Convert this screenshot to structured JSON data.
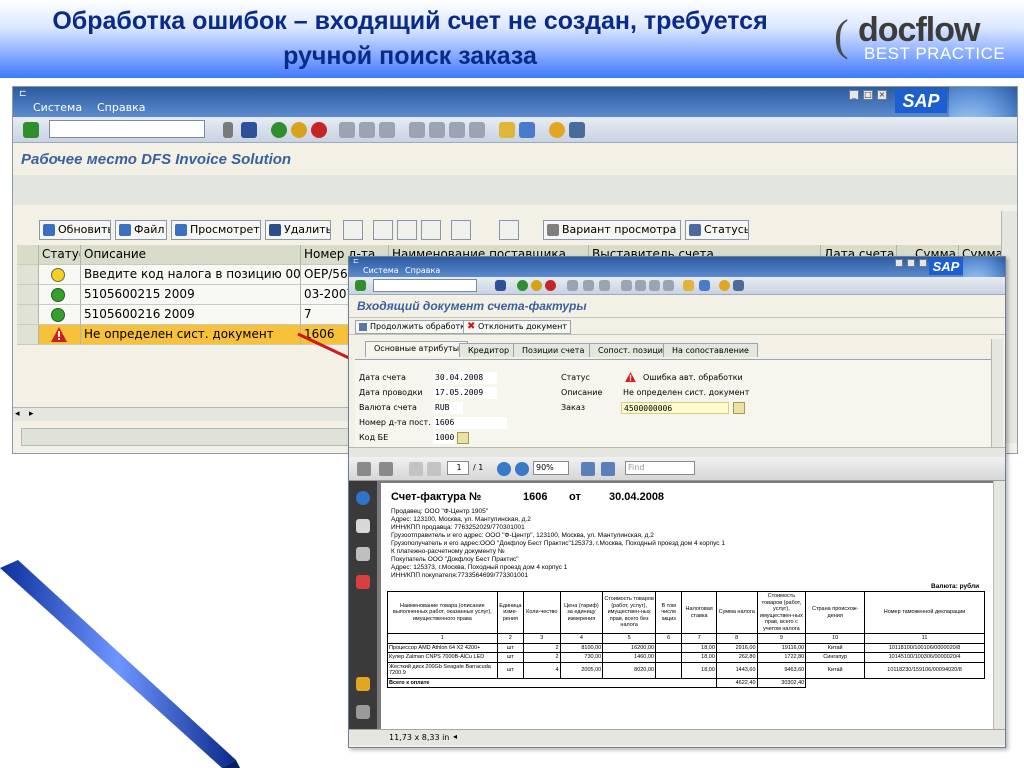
{
  "slide": {
    "title": "Обработка ошибок – входящий счет не создан, требуется ручной поиск заказа",
    "logo_word": "docflow",
    "logo_sub": "BEST PRACTICE"
  },
  "back_window": {
    "menu": [
      "Система",
      "Справка"
    ],
    "sap_logo": "SAP",
    "title": "Рабочее место DFS Invoice Solution",
    "alv_buttons": [
      "Обновить",
      "Файл",
      "Просмотреть",
      "Удалить",
      "Вариант просмотра",
      "Статусы"
    ],
    "columns": [
      "Статус",
      "Описание",
      "Номер д-та",
      "Наименование поставщика",
      "Выставитель счета",
      "Дата счета",
      "Сумма",
      "Сумма"
    ],
    "rows": [
      {
        "status": "warning",
        "description": "Введите код налога в позицию 000001",
        "doc": "OEP/563"
      },
      {
        "status": "ok",
        "description": "5105600215 2009",
        "doc": "03-2007/"
      },
      {
        "status": "ok",
        "description": "5105600216 2009",
        "doc": "7"
      },
      {
        "status": "error",
        "description": "Не определен сист. документ",
        "doc": "1606"
      }
    ]
  },
  "front_window": {
    "menu": [
      "Система",
      "Справка"
    ],
    "sap_logo": "SAP",
    "title": "Входящий документ счета-фактуры",
    "actions": [
      "Продолжить обработку",
      "Отклонить документ"
    ],
    "tabs": [
      "Основные атрибуты",
      "Кредитор",
      "Позиции счета",
      "Сопост. позиции",
      "На сопоставление"
    ],
    "fields_left": [
      {
        "label": "Дата счета",
        "value": "30.04.2008"
      },
      {
        "label": "Дата проводки",
        "value": "17.05.2009"
      },
      {
        "label": "Валюта счета",
        "value": "RUB"
      },
      {
        "label": "Номер д-та пост.",
        "value": "1606"
      },
      {
        "label": "Код БЕ",
        "value": "1000"
      }
    ],
    "fields_right": [
      {
        "label": "Статус",
        "value": "Ошибка авт. обработки"
      },
      {
        "label": "Описание",
        "value": "Не определен сист. документ"
      },
      {
        "label": "Заказ",
        "value": "4500000006"
      }
    ]
  },
  "pdf_viewer": {
    "page_current": "1",
    "page_total": "/ 1",
    "zoom": "90%",
    "find_placeholder": "Find",
    "page_size": "11,73 x 8,33 in"
  },
  "invoice": {
    "title": "Счет-фактура №",
    "number": "1606",
    "ot": "от",
    "date": "30.04.2008",
    "lines": [
      "Продавец: ООО \"Ф-Центр 1905\"",
      "Адрес: 123100, Москва, ул. Мантулинская, д.2",
      "ИНН/КПП продавца: 7763252029/770301001",
      "Грузоотправитель и его адрес: ООО \"Ф-Центр\", 123100, Москва, ул. Мантулинская, д.2",
      "Грузополучатель и его адрес:ООО \"Докфлоу Бест Практис\"125373, г.Москва, Походный проезд дом 4 корпус 1",
      "К платежно-расчетному документу №",
      "Покупатель ООО \"Докфлоу Бест Практис\"",
      "Адрес: 125373, г.Москва, Походный проезд дом 4 корпус 1",
      "ИНН/КПП покупателя:7733564699/773301001"
    ],
    "currency": "Валюта: рубли",
    "headers": [
      "Наименование товара (описание выполненных работ, оказанных услуг), имущественного права",
      "Единица изме-рения",
      "Коли-чество",
      "Цена (тариф) за единицу измерения",
      "Стоимость товаров (работ, услуг), имуществен-ных прав, всего без налога",
      "В том числе акциз",
      "Налоговая ставка",
      "Сумма налога",
      "Стоимость товаров (работ, услуг), имуществен-ных прав, всего с учетом налога",
      "Страна происхож-дения",
      "Номер таможенной декларации"
    ],
    "column_numbers": [
      "1",
      "2",
      "3",
      "4",
      "5",
      "6",
      "7",
      "8",
      "9",
      "10",
      "11"
    ],
    "items": [
      [
        "Процессор AMD Athlon 64 X2 4200+",
        "шт",
        "2",
        "8100,00",
        "16200,00",
        "",
        "18,00",
        "2916,00",
        "19116,00",
        "Китай",
        "10118100/100106/0000020/8"
      ],
      [
        "Кулер Zalman CNPS 7000B-AlCu LED",
        "шт",
        "2",
        "730,00",
        "1460,00",
        "",
        "18,00",
        "262,80",
        "1722,80",
        "Сингапур",
        "10145100/100306/0000020/4"
      ],
      [
        "Жесткий диск 200Gb Seagate Barracuda 7200.9",
        "шт",
        "4",
        "2005,00",
        "8020,00",
        "",
        "18,00",
        "1443,60",
        "9463,60",
        "Китай",
        "10118230/159106/00094020/8"
      ]
    ],
    "total_label": "Всего к оплате",
    "total_tax": "4622,40",
    "total_amount": "30302,40"
  }
}
